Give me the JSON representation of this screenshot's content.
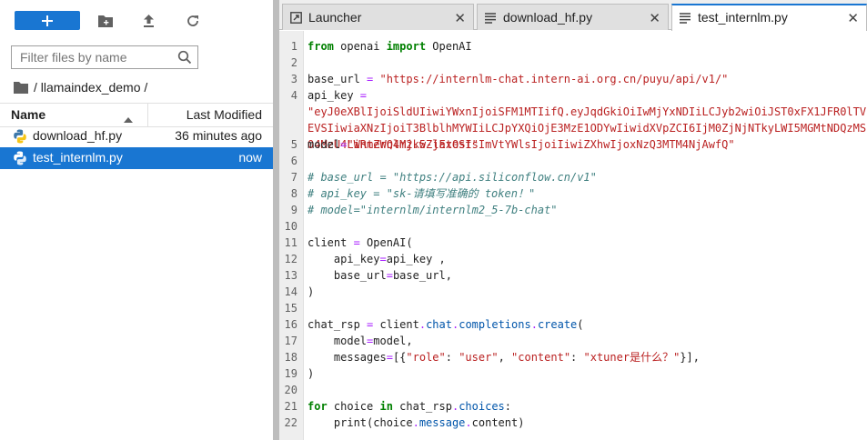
{
  "file_browser": {
    "filter_placeholder": "Filter files by name",
    "breadcrumb": " / llamaindex_demo /",
    "columns": {
      "name": "Name",
      "last_modified": "Last Modified"
    },
    "files": [
      {
        "name": "download_hf.py",
        "modified": "36 minutes ago",
        "selected": false
      },
      {
        "name": "test_internlm.py",
        "modified": "now",
        "selected": true
      }
    ]
  },
  "tabs": [
    {
      "label": "Launcher",
      "icon": "launcher-icon",
      "close": "✕"
    },
    {
      "label": "download_hf.py",
      "icon": "text-file-icon",
      "close": "✕"
    },
    {
      "label": "test_internlm.py",
      "icon": "text-file-icon",
      "close": "✕"
    }
  ],
  "editor": {
    "lines": [
      {
        "n": "1",
        "code": [
          "from",
          " openai ",
          "import",
          " OpenAI"
        ]
      },
      {
        "n": "2"
      },
      {
        "n": "3",
        "code": [
          "base_url ",
          "=",
          " ",
          "\"https://internlm-chat.intern-ai.org.cn/puyu/api/v1/\""
        ]
      },
      {
        "n": "4",
        "code": [
          "api_key ",
          "="
        ],
        "wrap": "\"eyJ0eXBlIjoiSldUIiwiYWxnIjoiSFM1MTIifQ.eyJqdGkiOiIwMjYxNDIiLCJyb2wiOiJST0xFX1JFR0lTVEVSIiwiaXNzIjoiT3BlblhMYWIiLCJpYXQiOjE3MzE1ODYwIiwidXVpZCI6IjM0ZjNjNTkyLWI5MGMtNDQzMS04MzU4LWRmZWQ4MjkwZjExOSIsImVtYWlsIjoiIiwiZXhwIjoxNzQ3MTM4NjAwfQ\""
      },
      {
        "n": "5",
        "code": [
          "model",
          "=",
          "\"internlm2.5-latest\""
        ]
      },
      {
        "n": "6"
      },
      {
        "n": "7",
        "comment": "# base_url = \"https://api.siliconflow.cn/v1\""
      },
      {
        "n": "8",
        "comment": "# api_key = \"sk-请填写准确的 token！\""
      },
      {
        "n": "9",
        "comment": "# model=\"internlm/internlm2_5-7b-chat\""
      },
      {
        "n": "10"
      },
      {
        "n": "11",
        "code": [
          "client ",
          "=",
          " OpenAI("
        ]
      },
      {
        "n": "12",
        "code": [
          "    api_key",
          "=",
          "api_key ,"
        ]
      },
      {
        "n": "13",
        "code": [
          "    base_url",
          "=",
          "base_url,"
        ]
      },
      {
        "n": "14",
        "code": [
          ")"
        ]
      },
      {
        "n": "15"
      },
      {
        "n": "16",
        "code": [
          "chat_rsp ",
          "=",
          " client",
          ".",
          "chat",
          ".",
          "completions",
          ".",
          "create",
          "("
        ]
      },
      {
        "n": "17",
        "code": [
          "    model",
          "=",
          "model,"
        ]
      },
      {
        "n": "18",
        "code": [
          "    messages",
          "=",
          "[{",
          "\"role\"",
          ": ",
          "\"user\"",
          ", ",
          "\"content\"",
          ": ",
          "\"xtuner是什么？\"",
          "}],"
        ]
      },
      {
        "n": "19",
        "code": [
          ")"
        ]
      },
      {
        "n": "20"
      },
      {
        "n": "21",
        "code": [
          "for",
          " choice ",
          "in",
          " chat_rsp",
          ".",
          "choices",
          ":"
        ]
      },
      {
        "n": "22",
        "code": [
          "    print(choice",
          ".",
          "message",
          ".",
          "content)"
        ]
      }
    ]
  },
  "colors": {
    "accent": "#1976d2",
    "keyword": "#008000",
    "string": "#ba2121",
    "comment": "#408080"
  }
}
